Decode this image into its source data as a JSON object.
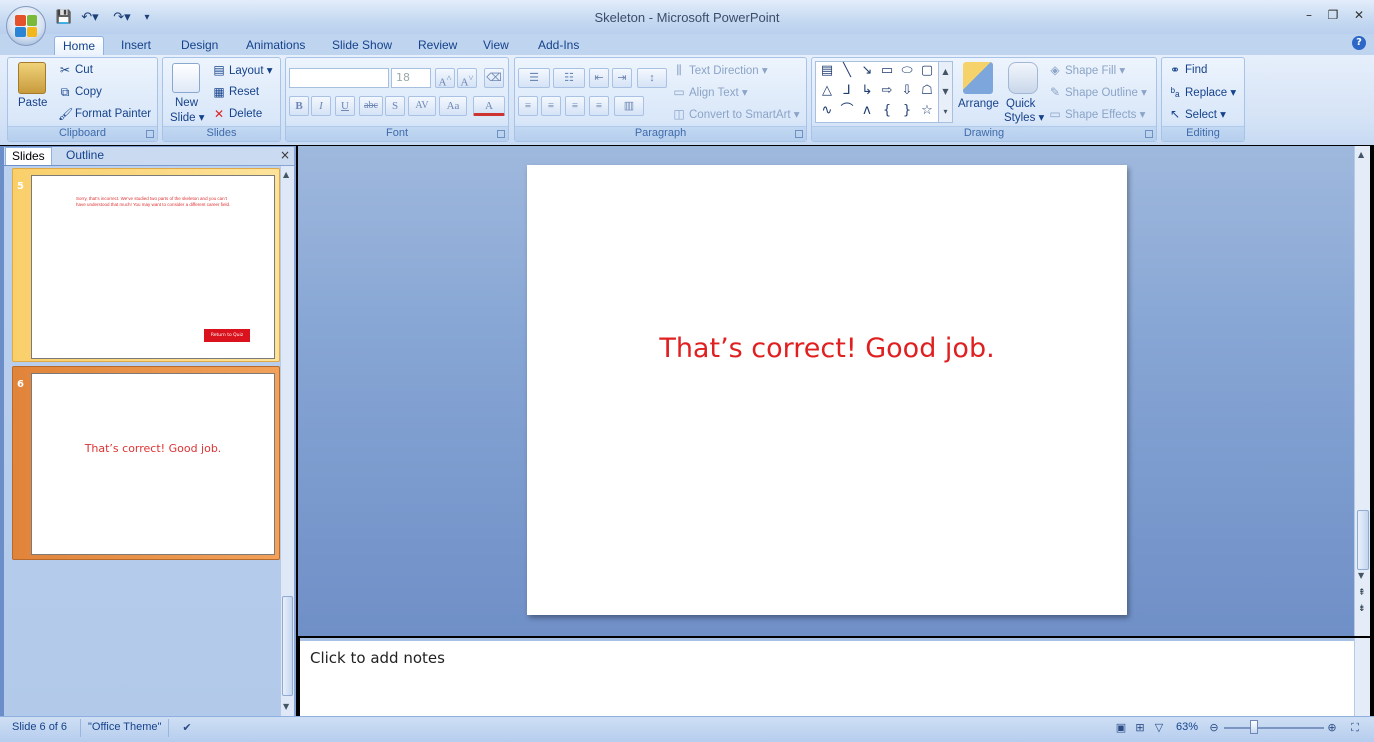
{
  "window": {
    "title": "Skeleton - Microsoft PowerPoint"
  },
  "tabs": [
    "Home",
    "Insert",
    "Design",
    "Animations",
    "Slide Show",
    "Review",
    "View",
    "Add-Ins"
  ],
  "active_tab": "Home",
  "clipboard": {
    "paste": "Paste",
    "cut": "Cut",
    "copy": "Copy",
    "format_painter": "Format Painter",
    "group": "Clipboard"
  },
  "slides_group": {
    "new_slide_1": "New",
    "new_slide_2": "Slide ▾",
    "layout": "Layout ▾",
    "reset": "Reset",
    "delete": "Delete",
    "group": "Slides"
  },
  "font": {
    "family": "",
    "size": "18",
    "group": "Font",
    "bold": "B",
    "italic": "I",
    "underline": "U",
    "strike": "abc",
    "shadow": "S",
    "spacing": "AV",
    "case": "Aa",
    "color": "A"
  },
  "paragraph": {
    "text_direction": "Text Direction ▾",
    "align_text": "Align Text ▾",
    "convert": "Convert to SmartArt ▾",
    "group": "Paragraph"
  },
  "drawing": {
    "arrange": "Arrange",
    "quick_1": "Quick",
    "quick_2": "Styles ▾",
    "shape_fill": "Shape Fill ▾",
    "shape_outline": "Shape Outline ▾",
    "shape_effects": "Shape Effects ▾",
    "group": "Drawing"
  },
  "editing": {
    "find": "Find",
    "replace": "Replace ▾",
    "select": "Select ▾",
    "group": "Editing"
  },
  "panel": {
    "tab_slides": "Slides",
    "tab_outline": "Outline",
    "close": "×"
  },
  "thumbs": [
    {
      "number": "5",
      "text": "Sorry, that’s incorrect. We’ve studied two parts of the skeleton and you can’t have understood that much! You may want to consider a different career field.",
      "button": "Return to Quiz"
    },
    {
      "number": "6",
      "text": "That’s correct!  Good job."
    }
  ],
  "slide": {
    "text": "That’s correct!  Good job."
  },
  "notes": {
    "placeholder": "Click to add notes"
  },
  "status": {
    "slide": "Slide 6 of 6",
    "theme": "\"Office Theme\"",
    "zoom": "63%"
  }
}
